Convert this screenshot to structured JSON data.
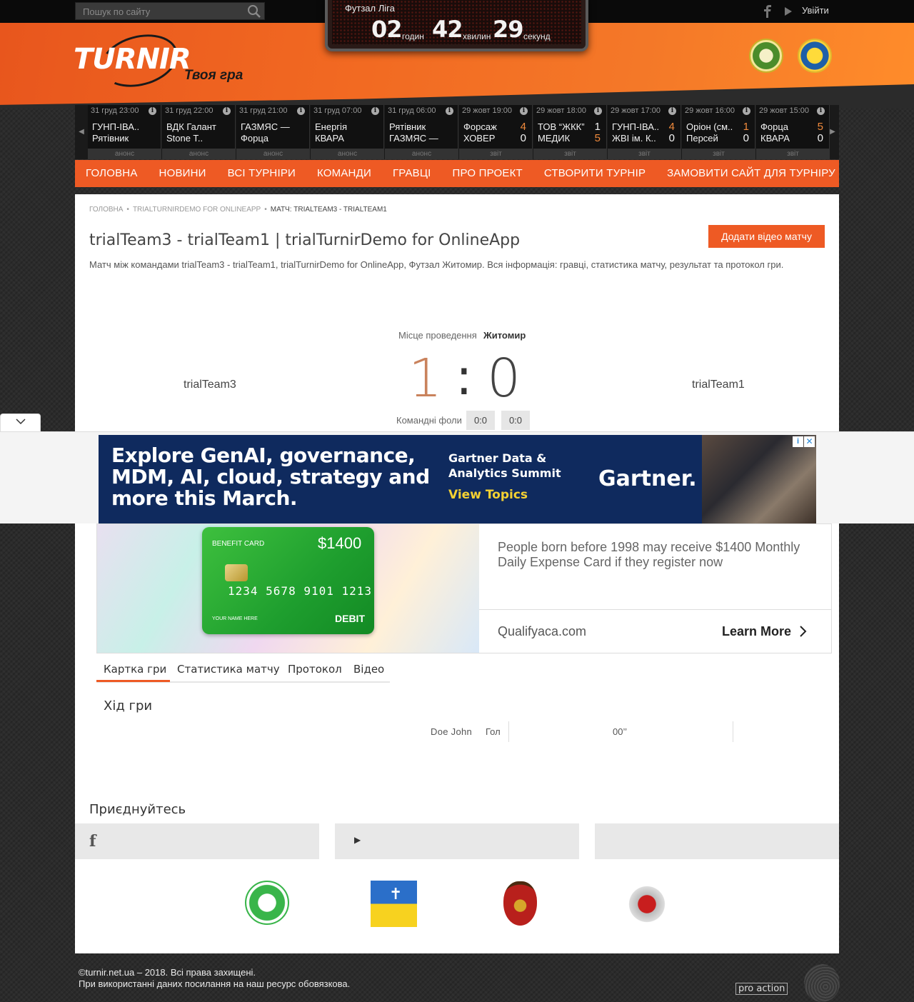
{
  "search": {
    "placeholder": "Пошук по сайту"
  },
  "topbar": {
    "login": "Увійти"
  },
  "scoreboard": {
    "title": "Футзал Ліга",
    "hours": "02",
    "hours_unit": "годин",
    "minutes": "42",
    "minutes_unit": "хвилин",
    "seconds": "29",
    "seconds_unit": "секунд"
  },
  "header": {
    "logo": "TURNIR",
    "tagline": "Твоя гра"
  },
  "ticker": [
    {
      "date": "31 груд 23:00",
      "team1": "ГУНП-ІВА..",
      "team2": "Рятівник",
      "score1": "",
      "score2": "",
      "status": "анонс"
    },
    {
      "date": "31 груд 22:00",
      "team1": "ВДК Галант",
      "team2": "Stone T..",
      "score1": "",
      "score2": "",
      "status": "анонс"
    },
    {
      "date": "31 груд 21:00",
      "team1": "ГАЗМЯС —",
      "team2": "Форца",
      "score1": "",
      "score2": "",
      "status": "анонс"
    },
    {
      "date": "31 груд 07:00",
      "team1": "Енергія",
      "team2": "КВАРА",
      "score1": "",
      "score2": "",
      "status": "анонс"
    },
    {
      "date": "31 груд 06:00",
      "team1": "Рятівник",
      "team2": "ГАЗМЯС —",
      "score1": "",
      "score2": "",
      "status": "анонс"
    },
    {
      "date": "29 жовт 19:00",
      "team1": "Форсаж",
      "team2": "ХОВЕР",
      "score1": "4",
      "score2": "0",
      "status": "звіт"
    },
    {
      "date": "29 жовт 18:00",
      "team1": "ТОВ “ЖКК”",
      "team2": "МЕДИК",
      "score1": "1",
      "score2": "5",
      "status": "звіт"
    },
    {
      "date": "29 жовт 17:00",
      "team1": "ГУНП-ІВА..",
      "team2": "ЖВІ ім. К..",
      "score1": "4",
      "score2": "0",
      "status": "звіт"
    },
    {
      "date": "29 жовт 16:00",
      "team1": "Оріон (см..",
      "team2": "Персей",
      "score1": "1",
      "score2": "0",
      "status": "звіт"
    },
    {
      "date": "29 жовт 15:00",
      "team1": "Форца",
      "team2": "КВАРА",
      "score1": "5",
      "score2": "0",
      "status": "звіт"
    }
  ],
  "nav": [
    "Головна",
    "Новини",
    "Всі турніри",
    "Команди",
    "Гравці",
    "Про проект",
    "Створити турнір",
    "Замовити сайт для турніру"
  ],
  "breadcrumb": [
    "Головна",
    "trialTurnirDemo for OnlineApp",
    "Матч: trialTeam3 - trialTeam1"
  ],
  "page": {
    "title": "trialTeam3 - trialTeam1 | trialTurnirDemo for OnlineApp",
    "add_video": "Додати відео матчу",
    "description": "Матч між командами trialTeam3 - trialTeam1, trialTurnirDemo for OnlineApp, Футзал Житомир. Вся інформація: гравці, статистика матчу, результат та протокол гри."
  },
  "match": {
    "venue_label": "Місце проведення",
    "venue": "Житомир",
    "home": "trialTeam3",
    "away": "trialTeam1",
    "score_home": "1",
    "score_sep": ":",
    "score_away": "0",
    "fouls_label": "Командні фоли",
    "fouls_home": "0:0",
    "fouls_away": "0:0"
  },
  "ad1": {
    "headline_1": "Explore GenAI, governance,",
    "headline_2": "MDM, AI, cloud, strategy and",
    "headline_3": "more this March.",
    "sub_1": "Gartner Data &",
    "sub_2": "Analytics Summit",
    "cta": "View Topics",
    "brand": "Gartner."
  },
  "ad2": {
    "card_label": "BENEFIT CARD",
    "card_amount": "$1400",
    "card_number": "1234 5678 9101 1213",
    "card_name": "YOUR NAME HERE",
    "card_type": "DEBIT",
    "text": "People born before 1998 may receive $1400 Monthly Daily Expense Card if they register now",
    "site": "Qualifyaca.com",
    "learn_more": "Learn More"
  },
  "tabs": [
    "Картка гри",
    "Статистика матчу",
    "Протокол",
    "Відео"
  ],
  "events": {
    "title": "Хід гри",
    "player": "Doe John",
    "type": "Гол",
    "time": "00’’"
  },
  "join": {
    "title": "Приєднуйтесь"
  },
  "footer": {
    "copyright": "©turnir.net.ua – 2018. Всі права захищені.",
    "notice": "При використанні даних посилання на наш ресурс обовязкова.",
    "brand": "pro action"
  }
}
